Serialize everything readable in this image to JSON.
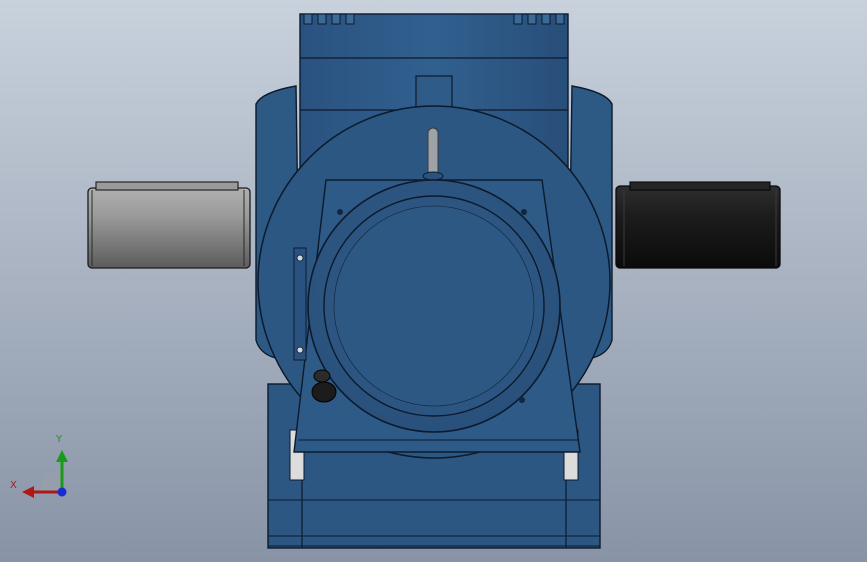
{
  "view": {
    "background_top": "#c9d3dd",
    "background_bottom": "#8b96a8",
    "body_color": "#2f5a86",
    "body_dark": "#1d3a5c",
    "edge_color": "#0c1a2c",
    "left_shaft_color": "#8a8a8a",
    "right_shaft_color": "#1a1a1a"
  },
  "triad": {
    "x_label": "X",
    "y_label": "Y",
    "x_color": "#b01818",
    "y_color": "#1a9a1a",
    "z_color": "#1a2bd0"
  }
}
